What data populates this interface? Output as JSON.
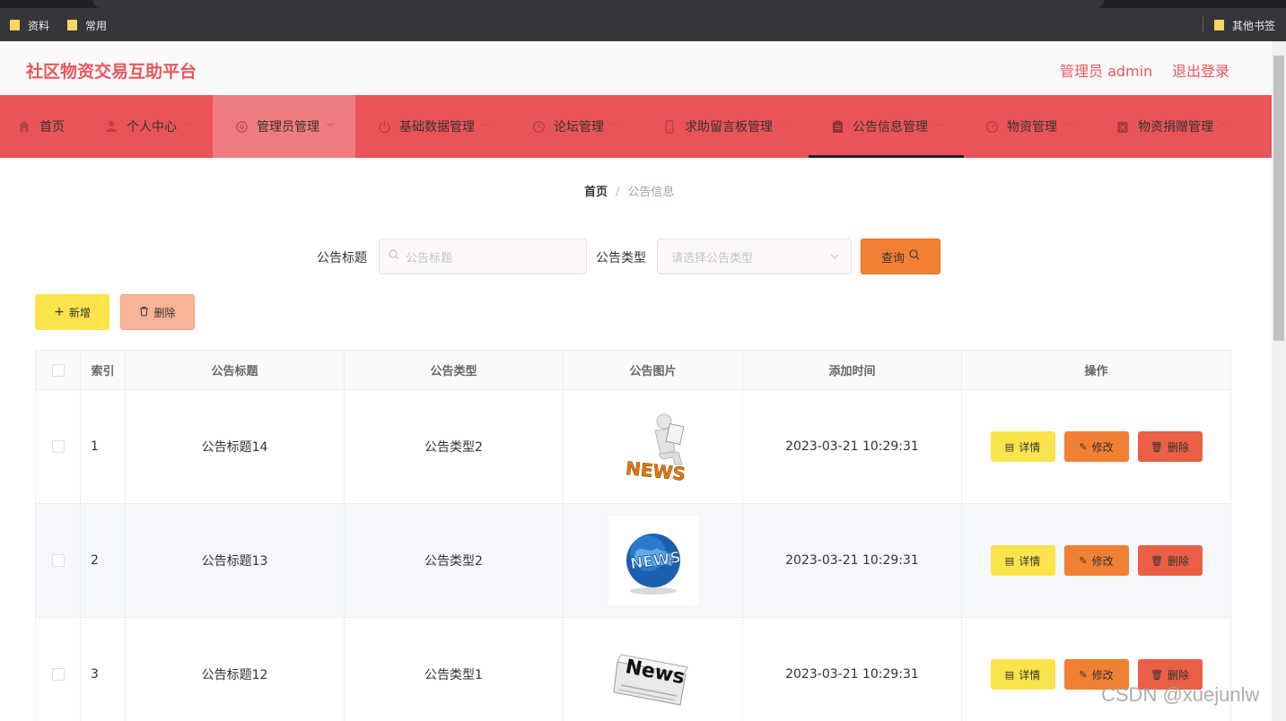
{
  "browser": {
    "bookmarks": [
      "资料",
      "常用"
    ],
    "other_bookmarks": "其他书签"
  },
  "header": {
    "title": "社区物资交易互助平台",
    "user": "管理员 admin",
    "logout": "退出登录"
  },
  "nav": {
    "items": [
      {
        "label": "首页",
        "icon": "home-icon"
      },
      {
        "label": "个人中心",
        "icon": "user-icon"
      },
      {
        "label": "管理员管理",
        "icon": "gear-icon"
      },
      {
        "label": "基础数据管理",
        "icon": "power-icon"
      },
      {
        "label": "论坛管理",
        "icon": "clock-icon"
      },
      {
        "label": "求助留言板管理",
        "icon": "phone-icon"
      },
      {
        "label": "公告信息管理",
        "icon": "clipboard-icon"
      },
      {
        "label": "物资管理",
        "icon": "gauge-icon"
      },
      {
        "label": "物资捐赠管理",
        "icon": "box-icon"
      }
    ],
    "active": "公告信息管理"
  },
  "breadcrumb": {
    "home": "首页",
    "current": "公告信息"
  },
  "search": {
    "title_label": "公告标题",
    "title_placeholder": "公告标题",
    "type_label": "公告类型",
    "type_placeholder": "请选择公告类型",
    "query_button": "查询"
  },
  "actions": {
    "add": "新增",
    "delete": "删除"
  },
  "table": {
    "headers": [
      "索引",
      "公告标题",
      "公告类型",
      "公告图片",
      "添加时间",
      "操作"
    ],
    "rows": [
      {
        "index": "1",
        "title": "公告标题14",
        "type": "公告类型2",
        "time": "2023-03-21 10:29:31",
        "image": "news-man-image"
      },
      {
        "index": "2",
        "title": "公告标题13",
        "type": "公告类型2",
        "time": "2023-03-21 10:29:31",
        "image": "news-globe-image"
      },
      {
        "index": "3",
        "title": "公告标题12",
        "type": "公告类型1",
        "time": "2023-03-21 10:29:31",
        "image": "newspaper-image"
      }
    ],
    "op_labels": {
      "detail": "详情",
      "edit": "修改",
      "delete": "删除"
    }
  },
  "watermark": "CSDN @xuejunlw"
}
